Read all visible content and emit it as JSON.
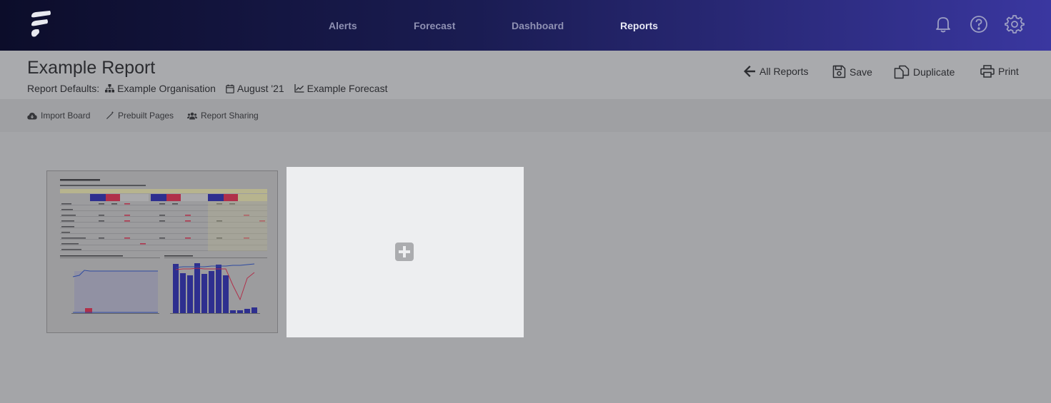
{
  "nav": {
    "items": [
      {
        "label": "Alerts",
        "active": false
      },
      {
        "label": "Forecast",
        "active": false
      },
      {
        "label": "Dashboard",
        "active": false
      },
      {
        "label": "Reports",
        "active": true
      }
    ],
    "icons": [
      "bell-icon",
      "help-icon",
      "gear-icon"
    ]
  },
  "report": {
    "title": "Example Report",
    "defaults_label": "Report Defaults:",
    "organisation": "Example Organisation",
    "period": "August '21",
    "forecast": "Example Forecast"
  },
  "actions": {
    "all_reports": "All Reports",
    "save": "Save",
    "duplicate": "Duplicate",
    "print": "Print"
  },
  "toolbar": {
    "import_board": "Import Board",
    "prebuilt_pages": "Prebuilt Pages",
    "report_sharing": "Report Sharing"
  },
  "colors": {
    "nav_start": "#0c0d2a",
    "nav_end": "#3a37a0",
    "accent_blue": "#2e2f8f",
    "accent_red": "#b0304a"
  }
}
